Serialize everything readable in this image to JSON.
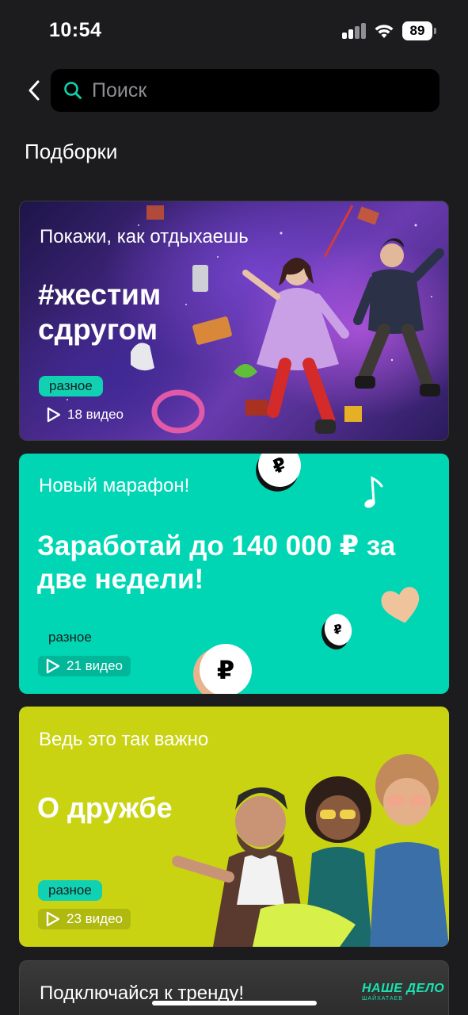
{
  "status_bar": {
    "time": "10:54",
    "battery": "89"
  },
  "search": {
    "placeholder": "Поиск"
  },
  "section_title": "Подборки",
  "cards": [
    {
      "subtitle": "Покажи, как отдыхаешь",
      "title": "#жестим сдругом",
      "tag": "разное",
      "videos": "18 видео"
    },
    {
      "subtitle": "Новый марафон!",
      "title": "Заработай до 140 000 ₽ за две недели!",
      "tag": "разное",
      "videos": "21 видео"
    },
    {
      "subtitle": "Ведь это так важно",
      "title": "О дружбе",
      "tag": "разное",
      "videos": "23 видео"
    },
    {
      "subtitle": "Подключайся к тренду!",
      "brand": "НАШЕ ДЕЛО",
      "brand_sub": "ШАЙХАТАЕВ"
    }
  ],
  "colors": {
    "background": "#1c1c1e",
    "teal": "#00d6b4",
    "lime": "#c9d312",
    "accent": "#10d2b3"
  },
  "icons": [
    "back-chevron-icon",
    "search-icon",
    "play-icon",
    "ruble-coin-icon",
    "music-note-icon",
    "heart-icon",
    "signal-icon",
    "wifi-icon",
    "battery-icon"
  ]
}
